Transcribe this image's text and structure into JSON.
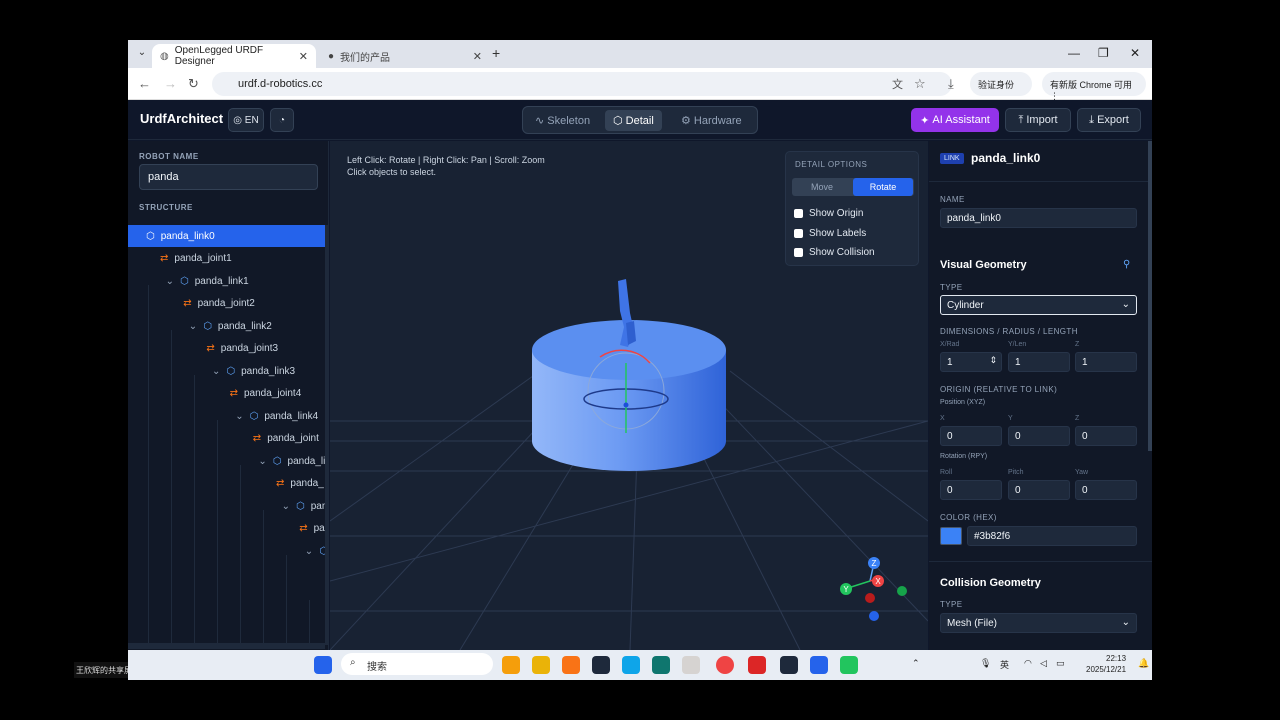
{
  "browser": {
    "tabs": [
      {
        "label": "OpenLegged URDF Designer"
      },
      {
        "label": "我们的产品"
      }
    ],
    "url": "urdf.d-robotics.cc",
    "profile_label": "验证身份",
    "update_label": "有新版 Chrome 可用"
  },
  "app": {
    "brand": "UrdfArchitect",
    "lang": "EN",
    "modes": [
      {
        "label": "Skeleton"
      },
      {
        "label": "Detail"
      },
      {
        "label": "Hardware"
      }
    ],
    "ai_label": "AI Assistant",
    "import_label": "Import",
    "export_label": "Export"
  },
  "left": {
    "robot_name_label": "ROBOT NAME",
    "robot_name": "panda",
    "structure_label": "STRUCTURE",
    "tree": [
      {
        "label": "panda_link0",
        "kind": "link"
      },
      {
        "label": "panda_joint1",
        "kind": "joint"
      },
      {
        "label": "panda_link1",
        "kind": "link"
      },
      {
        "label": "panda_joint2",
        "kind": "joint"
      },
      {
        "label": "panda_link2",
        "kind": "link"
      },
      {
        "label": "panda_joint3",
        "kind": "joint"
      },
      {
        "label": "panda_link3",
        "kind": "link"
      },
      {
        "label": "panda_joint4",
        "kind": "joint"
      },
      {
        "label": "panda_link4",
        "kind": "link"
      },
      {
        "label": "panda_joint",
        "kind": "joint"
      },
      {
        "label": "panda_lin",
        "kind": "link"
      },
      {
        "label": "panda_",
        "kind": "joint"
      },
      {
        "label": "pand",
        "kind": "link"
      },
      {
        "label": "pa",
        "kind": "joint"
      },
      {
        "label": "",
        "kind": "link"
      }
    ]
  },
  "viewport": {
    "hint_line1": "Left Click: Rotate | Right Click: Pan | Scroll: Zoom",
    "hint_line2": "Click objects to select.",
    "options_title": "DETAIL OPTIONS",
    "move_label": "Move",
    "rotate_label": "Rotate",
    "show_origin": "Show Origin",
    "show_labels": "Show Labels",
    "show_collision": "Show Collision",
    "gizmo_z": "Z",
    "gizmo_y": "Y",
    "gizmo_x": "X"
  },
  "right": {
    "badge": "LINK",
    "title": "panda_link0",
    "name_label": "NAME",
    "name_value": "panda_link0",
    "visual_title": "Visual Geometry",
    "type_label": "TYPE",
    "visual_type": "Cylinder",
    "dims_label": "DIMENSIONS / RADIUS / LENGTH",
    "dim_subs": [
      "X/Rad",
      "Y/Len",
      "Z"
    ],
    "dims": [
      "1",
      "1",
      "1"
    ],
    "origin_label": "ORIGIN (RELATIVE TO LINK)",
    "position_label": "Position (XYZ)",
    "pos_subs": [
      "X",
      "Y",
      "Z"
    ],
    "pos": [
      "0",
      "0",
      "0"
    ],
    "rotation_label": "Rotation (RPY)",
    "rot_subs": [
      "Roll",
      "Pitch",
      "Yaw"
    ],
    "rot": [
      "0",
      "0",
      "0"
    ],
    "color_label": "COLOR (HEX)",
    "color_value": "#3b82f6",
    "collision_title": "Collision Geometry",
    "collision_type_label": "TYPE",
    "collision_type": "Mesh (File)"
  },
  "taskbar": {
    "search": "搜索",
    "ime": "英",
    "time": "22:13",
    "date": "2025/12/21"
  },
  "caption": "王欣辉的共享屏幕",
  "colors": {
    "accent": "#2563eb",
    "ai": "#9333ea",
    "model": "#3b82f6"
  }
}
